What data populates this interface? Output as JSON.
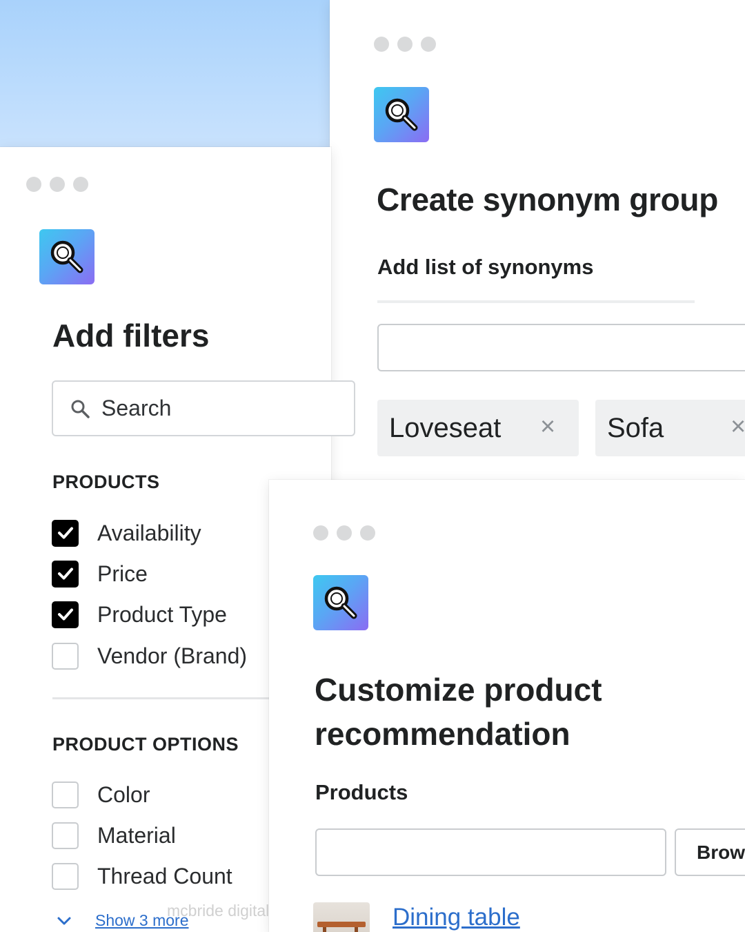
{
  "colors": {
    "link": "#2c6ecb",
    "checkbox_checked": "#000000",
    "icon_gradient": [
      "#3ec8f0",
      "#8b6cf3"
    ],
    "header_sky": "#b3d7fc"
  },
  "synonym_panel": {
    "window_dots": 3,
    "icon": "search-icon",
    "title": "Create synonym group",
    "subtitle": "Add list of synonyms",
    "input_value": "",
    "tags": [
      {
        "label": "Loveseat",
        "remove_icon": "×"
      },
      {
        "label": "Sofa",
        "remove_icon": "×"
      }
    ]
  },
  "filters_panel": {
    "window_dots": 3,
    "icon": "search-icon",
    "title": "Add filters",
    "search": {
      "placeholder": "Search",
      "value": ""
    },
    "sections": [
      {
        "title": "PRODUCTS",
        "items": [
          {
            "label": "Availability",
            "checked": true
          },
          {
            "label": "Price",
            "checked": true
          },
          {
            "label": "Product Type",
            "checked": true
          },
          {
            "label": "Vendor (Brand)",
            "checked": false
          }
        ]
      },
      {
        "title": "PRODUCT OPTIONS",
        "items": [
          {
            "label": "Color",
            "checked": false
          },
          {
            "label": "Material",
            "checked": false
          },
          {
            "label": "Thread Count",
            "checked": false
          }
        ]
      }
    ],
    "show_more": "Show 3 more"
  },
  "recommendation_panel": {
    "window_dots": 3,
    "icon": "search-icon",
    "title": "Customize product recommendation",
    "subtitle": "Products",
    "input_value": "",
    "browse_label": "Browse",
    "product_link": "Dining table"
  },
  "watermark": "mcbride digital"
}
